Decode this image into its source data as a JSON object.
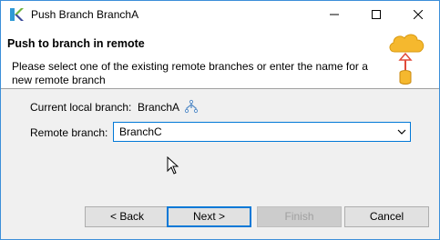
{
  "window": {
    "title": "Push Branch BranchA"
  },
  "header": {
    "title": "Push to branch in remote",
    "description": "Please select one of the existing remote branches or enter the name for a new remote branch"
  },
  "form": {
    "current_branch_label": "Current local branch:",
    "current_branch_value": "BranchA",
    "remote_branch_label": "Remote branch:",
    "remote_branch_value": "BranchC"
  },
  "buttons": {
    "back": "< Back",
    "next": "Next >",
    "finish": "Finish",
    "cancel": "Cancel"
  },
  "colors": {
    "accent": "#0078d7",
    "window_border": "#3c8fd9",
    "cloud": "#f5b82e",
    "arrow": "#e04a3a"
  },
  "icons": {
    "app": "eclipse-k-icon",
    "branch": "branch-icon",
    "wizard": "cloud-upload-icon"
  }
}
